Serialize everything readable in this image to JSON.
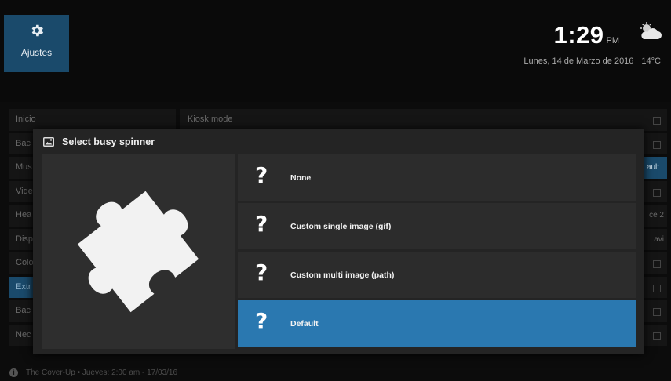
{
  "header": {
    "settings_tile": {
      "label": "Ajustes",
      "icon": "gear-icon"
    },
    "clock": {
      "time": "1:29",
      "ampm": "PM"
    },
    "date": "Lunes, 14 de Marzo de 2016",
    "temperature": "14°C",
    "weather_icon": "partly-cloudy-icon"
  },
  "background_list": {
    "items": [
      "Inicio",
      "Bac",
      "Mus",
      "Vide",
      "Hea",
      "Disp",
      "Colo",
      "Extr",
      "Bac",
      "Nec"
    ],
    "active_index": 7
  },
  "background_right": {
    "first_row_label": "Kiosk mode",
    "trail_labels": [
      "",
      "",
      "ault",
      "",
      "ce 2",
      "avi",
      "",
      "",
      "",
      ""
    ]
  },
  "footer": {
    "text": "The Cover-Up • Jueves: 2:00 am - 17/03/16"
  },
  "dialog": {
    "title": "Select busy spinner",
    "title_icon": "image-icon",
    "preview_icon": "puzzle-piece-icon",
    "options": [
      {
        "label": "None",
        "glyph": "?"
      },
      {
        "label": "Custom single image (gif)",
        "glyph": "?"
      },
      {
        "label": "Custom multi image (path)",
        "glyph": "?"
      },
      {
        "label": "Default",
        "glyph": "?"
      }
    ],
    "focused_index": 3
  },
  "colors": {
    "accent": "#2a78b0",
    "tile": "#1a4a6b",
    "dialog_bg": "#242424"
  }
}
